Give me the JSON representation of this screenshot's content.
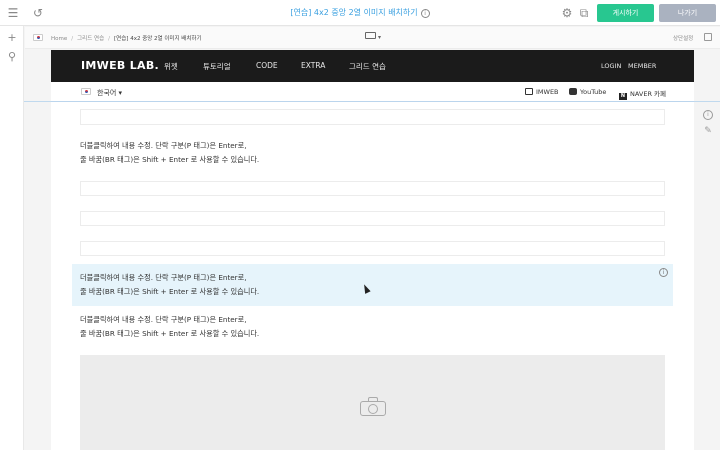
{
  "topbar": {
    "page_title": "[연습] 4x2 중앙 2열 이미지 배치하기",
    "publish_label": "게시하기",
    "exit_label": "나가기"
  },
  "breadcrumb": {
    "home": "Home",
    "section": "그리드 연습",
    "current": "[연습] 4x2 중앙 2열 이미지 배치하기"
  },
  "right_label": "상단설정",
  "site": {
    "logo": "IMWEB LAB.",
    "nav_items": [
      "위젯",
      "튜토리얼",
      "CODE",
      "EXTRA",
      "그리드 연습"
    ],
    "nav_right": [
      "LOGIN",
      "MEMBER"
    ],
    "language": "한국어",
    "sub_links": [
      "IMWEB",
      "YouTube",
      "NAVER 카페"
    ],
    "text_blocks": [
      {
        "line1": "더블클릭하여 내용 수정. 단락 구분(P 태그)은 Enter로,",
        "line2": "줄 바꿈(BR 태그)은 Shift + Enter 로 사용할 수 있습니다."
      },
      {
        "line1": "더블클릭하여 내용 수정. 단락 구분(P 태그)은 Enter로,",
        "line2": "줄 바꿈(BR 태그)은 Shift + Enter 로 사용할 수 있습니다."
      },
      {
        "line1": "더블클릭하여 내용 수정. 단락 구분(P 태그)은 Enter로,",
        "line2": "줄 바꿈(BR 태그)은 Shift + Enter 로 사용할 수 있습니다."
      }
    ]
  },
  "icons": {
    "menu": "hamburger-icon",
    "undo": "undo-icon",
    "add": "plus-icon",
    "design": "brush-icon",
    "settings": "gear-icon",
    "external": "external-link-icon",
    "info": "info-icon",
    "pin": "pin-icon",
    "camera": "camera-icon"
  },
  "colors": {
    "publish": "#28c790",
    "exit": "#aab2c0",
    "title": "#3aa0e0",
    "highlight": "#e6f4fb",
    "nav_bg": "#1b1b1b"
  }
}
